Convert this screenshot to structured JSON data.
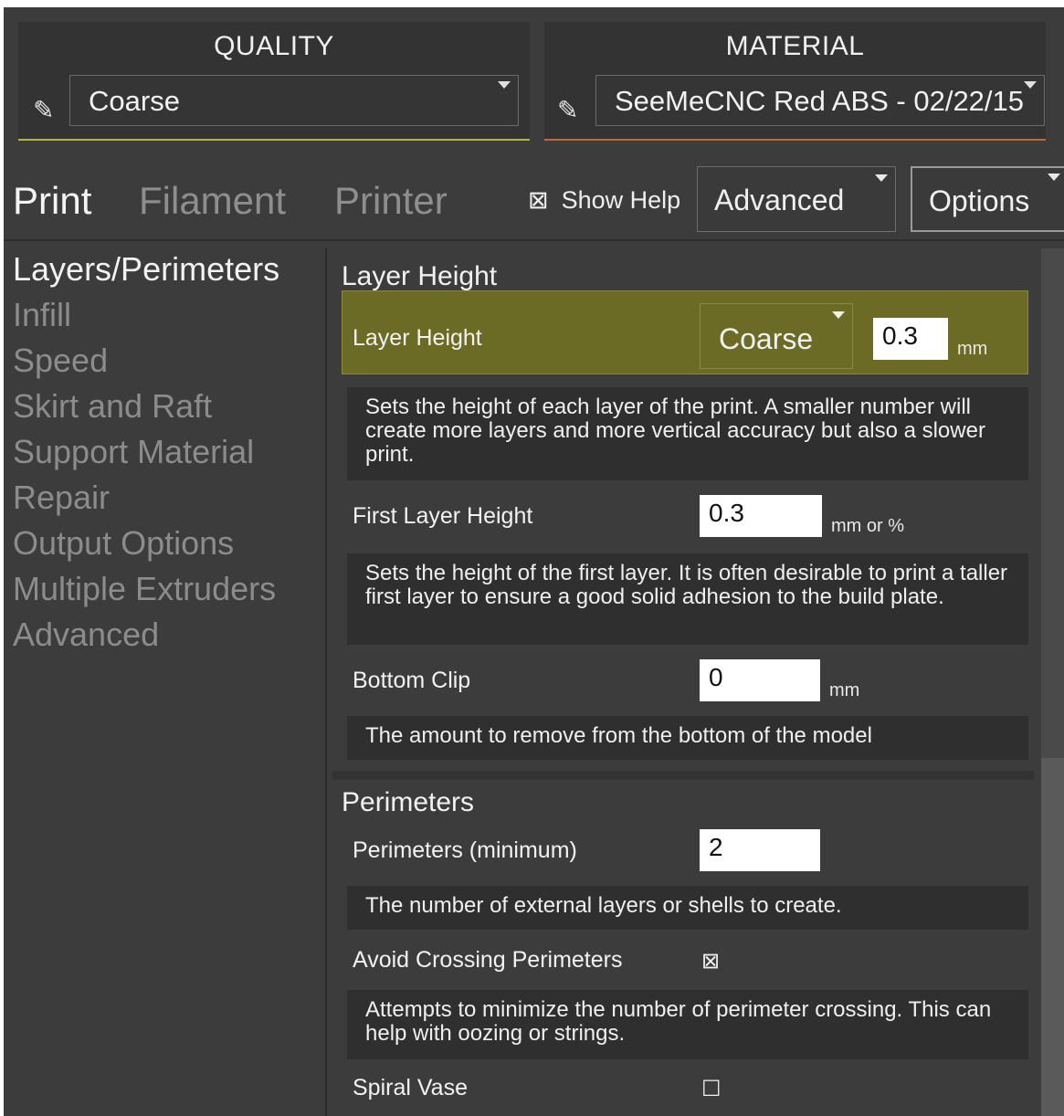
{
  "quality": {
    "title": "QUALITY",
    "value": "Coarse",
    "accent": "#b4b63a",
    "icon": "pencil-icon"
  },
  "material": {
    "title": "MATERIAL",
    "value": "SeeMeCNC Red ABS - 02/22/15",
    "accent": "#c4682e",
    "icon": "pencil-icon"
  },
  "tabs": [
    {
      "label": "Print",
      "active": true
    },
    {
      "label": "Filament",
      "active": false
    },
    {
      "label": "Printer",
      "active": false
    }
  ],
  "show_help": {
    "label": "Show Help",
    "checked": true,
    "glyph": "⊠"
  },
  "mode_dropdown": {
    "value": "Advanced"
  },
  "options_dropdown": {
    "label": "Options"
  },
  "nav": [
    {
      "label": "Layers/Perimeters",
      "active": true
    },
    {
      "label": "Infill"
    },
    {
      "label": "Speed"
    },
    {
      "label": "Skirt and Raft"
    },
    {
      "label": "Support Material"
    },
    {
      "label": "Repair"
    },
    {
      "label": "Output Options"
    },
    {
      "label": "Multiple Extruders"
    },
    {
      "label": "Advanced"
    }
  ],
  "layer_height_section": {
    "title": "Layer Height",
    "layer_height": {
      "label": "Layer Height",
      "preset": "Coarse",
      "value": "0.3",
      "unit": "mm",
      "help": "Sets the height of each layer of the print. A smaller number will create more layers and more vertical accuracy but also a slower print."
    },
    "first_layer_height": {
      "label": "First Layer Height",
      "value": "0.3",
      "unit": "mm or %",
      "help": "Sets the height of the first layer. It is often desirable to print a taller first layer to ensure a good solid adhesion to the build plate."
    },
    "bottom_clip": {
      "label": "Bottom Clip",
      "value": "0",
      "unit": "mm",
      "help": "The amount to remove from the bottom of the model"
    }
  },
  "perimeters_section": {
    "title": "Perimeters",
    "perimeters_minimum": {
      "label": "Perimeters (minimum)",
      "value": "2",
      "help": "The number of external layers or shells to create."
    },
    "avoid_crossing": {
      "label": "Avoid Crossing Perimeters",
      "checked": true,
      "glyph": "⊠",
      "help": "Attempts to minimize the number of perimeter crossing. This can help with oozing or strings."
    },
    "spiral_vase": {
      "label": "Spiral Vase",
      "checked": false,
      "glyph": "☐"
    }
  }
}
